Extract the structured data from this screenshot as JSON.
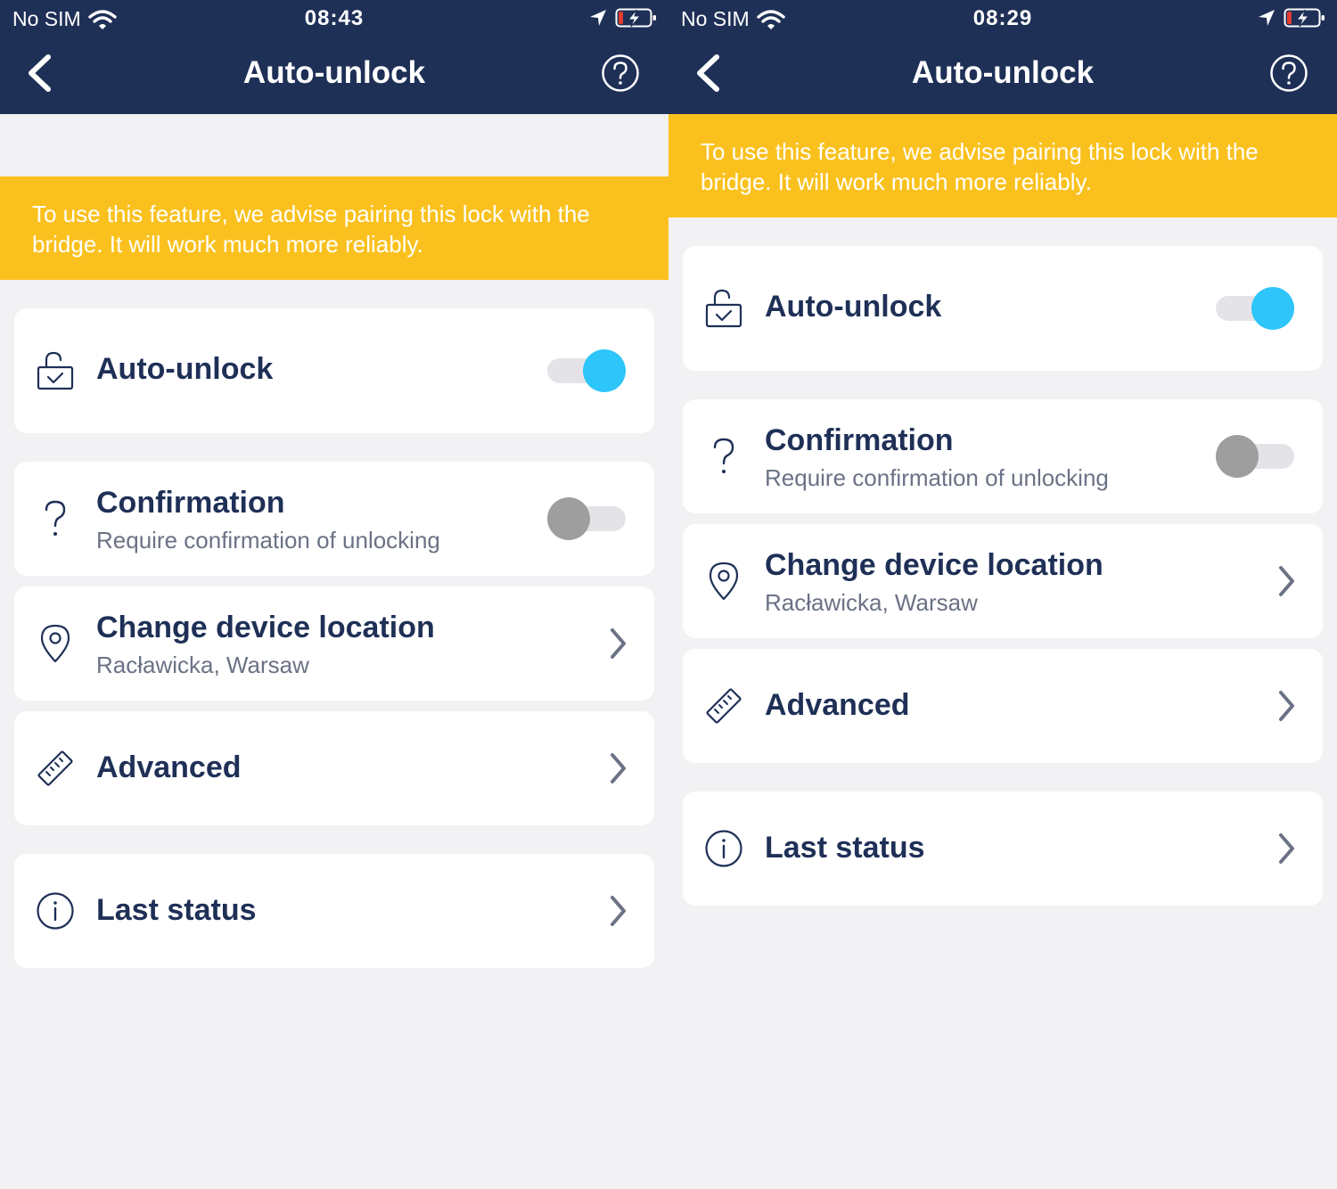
{
  "screens": [
    {
      "status": {
        "carrier": "No SIM",
        "time": "08:43"
      },
      "nav": {
        "title": "Auto-unlock"
      },
      "banner": {
        "text": "To use this feature, we advise pairing this lock with the bridge. It will work much more reliably."
      },
      "items": {
        "auto_unlock": {
          "title": "Auto-unlock",
          "enabled": true
        },
        "confirmation": {
          "title": "Confirmation",
          "subtitle": "Require confirmation of unlocking",
          "enabled": false
        },
        "location": {
          "title": "Change device location",
          "subtitle": "Racławicka, Warsaw"
        },
        "advanced": {
          "title": "Advanced"
        },
        "last_status": {
          "title": "Last status"
        }
      }
    },
    {
      "status": {
        "carrier": "No SIM",
        "time": "08:29"
      },
      "nav": {
        "title": "Auto-unlock"
      },
      "banner": {
        "text": "To use this feature, we advise pairing this lock with the bridge. It will work much more reliably."
      },
      "items": {
        "auto_unlock": {
          "title": "Auto-unlock",
          "enabled": true
        },
        "confirmation": {
          "title": "Confirmation",
          "subtitle": "Require confirmation of unlocking",
          "enabled": false
        },
        "location": {
          "title": "Change device location",
          "subtitle": "Racławicka, Warsaw"
        },
        "advanced": {
          "title": "Advanced"
        },
        "last_status": {
          "title": "Last status"
        }
      }
    }
  ],
  "colors": {
    "nav_bg": "#1f3057",
    "banner_bg": "#fac11e",
    "title_text": "#1f3057",
    "subtitle_text": "#6b7285",
    "toggle_on": "#2ec5fa",
    "toggle_off": "#9e9e9e",
    "screen_bg": "#f2f2f4",
    "battery_low": "#e23b30"
  },
  "icons": {
    "back": "chevron-left-icon",
    "help": "question-circle-icon",
    "auto_unlock": "unlocked-padlock-check-icon",
    "confirmation": "question-mark-icon",
    "location": "location-pin-icon",
    "advanced": "ruler-icon",
    "last_status": "info-circle-icon",
    "row_arrow": "chevron-right-icon"
  }
}
